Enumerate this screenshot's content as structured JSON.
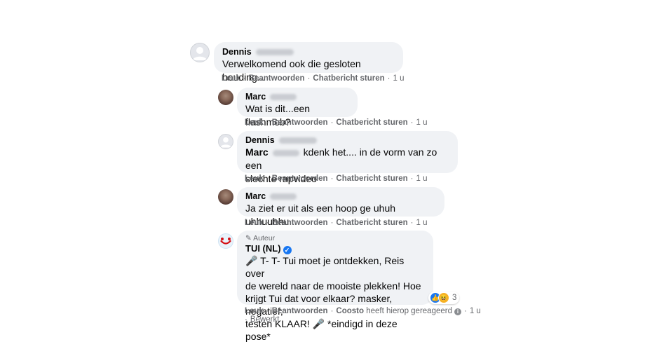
{
  "comments": [
    {
      "author_first": "Dennis",
      "author_last_blurred": true,
      "text": "Verwelkomend ook die gesloten houding...",
      "actions": [
        "Leuk",
        "Beantwoorden",
        "Chatbericht sturen"
      ],
      "time": "1 u"
    },
    {
      "author_first": "Marc",
      "author_last_blurred": true,
      "text": "Wat is dit...een flashmob?",
      "actions": [
        "Leuk",
        "Beantwoorden",
        "Chatbericht sturen"
      ],
      "time": "1 u"
    },
    {
      "author_first": "Dennis",
      "author_last_blurred": true,
      "mention": "Marc",
      "text_line1": " kdenk het.... in de vorm van zo een",
      "text_line2": "slechte rapvideo",
      "actions": [
        "Leuk",
        "Beantwoorden",
        "Chatbericht sturen"
      ],
      "time": "1 u"
    },
    {
      "author_first": "Marc",
      "author_last_blurred": true,
      "text": "Ja ziet er uit als een hoop ge uhuh uhhuuhhu...",
      "actions": [
        "Leuk",
        "Beantwoorden",
        "Chatbericht sturen"
      ],
      "time": "1 u"
    },
    {
      "author_tag": "Auteur",
      "author": "TUI (NL)",
      "verified": true,
      "text_lines": [
        "🎤 T- T- Tui moet je ontdekken, Reis over",
        "de wereld naar de mooiste plekken! Hoe",
        "krijgt Tui dat voor elkaar? masker, negatief,",
        "testen KLAAR! 🎤 *eindigd in deze pose*"
      ],
      "reaction_count": "3",
      "actions": [
        "Leuk",
        "Beantwoorden"
      ],
      "posted_by": "Coosto",
      "posted_by_suffix": "heeft hierop gereageerd",
      "time": "1 u",
      "edited": "Bewerkt"
    }
  ],
  "icons": {
    "verified": "verified-check-icon",
    "like": "like-reaction-icon",
    "haha": "haha-reaction-icon",
    "info": "info-icon",
    "author": "pencil-icon"
  },
  "colors": {
    "bubble": "#f0f2f5",
    "meta": "#65676b",
    "brand_blue": "#1877f2"
  }
}
